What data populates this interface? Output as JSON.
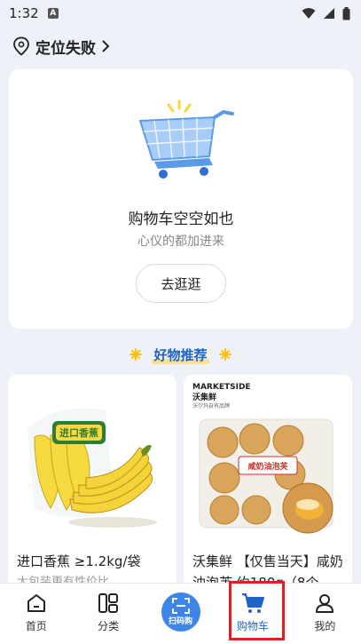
{
  "status_bar": {
    "time": "1:32",
    "app_badge": "A"
  },
  "location": {
    "label": "定位失败"
  },
  "empty_cart": {
    "title": "购物车空空如也",
    "subtitle": "心仪的都加进来",
    "button": "去逛逛"
  },
  "recommend": {
    "title": "好物推荐"
  },
  "products": [
    {
      "name": "进口香蕉 ≥1.2kg/袋",
      "sub": "大包装更有性价比",
      "badge": "进口香蕉"
    },
    {
      "name": "沃集鲜 【仅售当天】咸奶油泡芙 约180g（8个",
      "sub": "",
      "brand": "MARKETSIDE",
      "brand_cn": "沃集鲜",
      "brand_tag": "沃尔玛自有品牌",
      "pack_label": "咸奶油泡芙"
    }
  ],
  "tabs": [
    {
      "label": "首页"
    },
    {
      "label": "分类"
    },
    {
      "label": "扫码购"
    },
    {
      "label": "购物车"
    },
    {
      "label": "我的"
    }
  ],
  "colors": {
    "accent": "#1f63c9",
    "scan": "#3d86e8",
    "highlight": "#e02020",
    "background": "#eef2f8"
  }
}
